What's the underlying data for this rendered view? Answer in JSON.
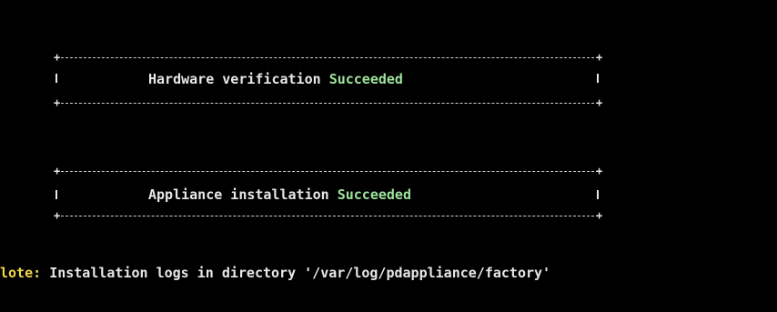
{
  "box1": {
    "label": "Hardware verification",
    "status": "Succeeded"
  },
  "box2": {
    "label": "Appliance installation",
    "status": "Succeeded"
  },
  "note": {
    "prefix": "lote:",
    "message": "Installation logs in directory '/var/log/pdappliance/factory'"
  },
  "colors": {
    "background": "#000000",
    "text": "#e8e8e8",
    "success": "#9ee49e",
    "note_prefix": "#f2d64b"
  }
}
